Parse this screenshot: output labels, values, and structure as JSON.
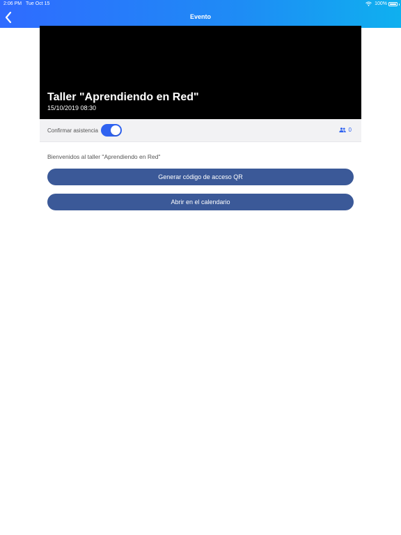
{
  "status_bar": {
    "time": "2:06 PM",
    "date": "Tue Oct 15",
    "battery": "100%",
    "icons": [
      "wifi-icon",
      "battery-icon"
    ]
  },
  "nav": {
    "title": "Evento",
    "back_icon": "chevron-left-icon"
  },
  "event": {
    "title": "Taller \"Aprendiendo en Red\"",
    "datetime": "15/10/2019 08:30"
  },
  "attendance": {
    "label": "Confirmar asistencia",
    "toggle_on": true,
    "attendee_icon": "people-icon",
    "attendee_count": "0"
  },
  "content": {
    "welcome": "Bienvenidos al taller \"Aprendiendo en Red\"",
    "qr_button": "Generar código de acceso QR",
    "calendar_button": "Abrir en el calendario"
  },
  "colors": {
    "accent": "#2f62f0",
    "button": "#3b5998",
    "header_start": "#2f6bff",
    "header_end": "#0fb0ef"
  }
}
